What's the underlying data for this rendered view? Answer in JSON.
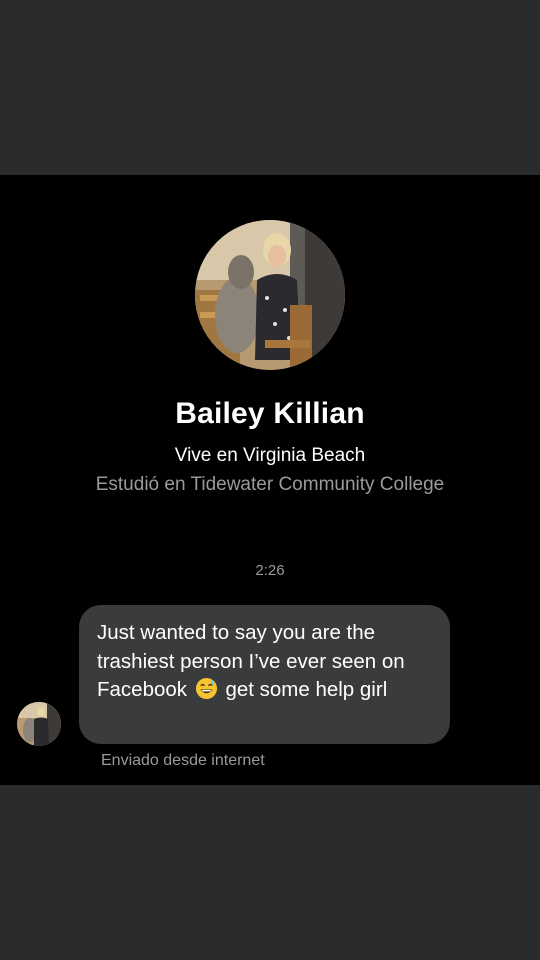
{
  "profile": {
    "name": "Bailey Killian",
    "location": "Vive en Virginia Beach",
    "education": "Estudió en Tidewater Community College",
    "photo_icon": "profile-photo"
  },
  "conversation": {
    "timestamp": "2:26",
    "message": {
      "text_before_emoji": "Just wanted to say you are the trashiest person I’ve ever seen on Facebook",
      "emoji_icon": "grinning-sweat-emoji-icon",
      "text_after_emoji": "get some help girl"
    },
    "sent_via": "Enviado desde internet"
  },
  "colors": {
    "page_background": "#2a2b2d",
    "chat_background": "#000000",
    "bubble_background": "#3a3b3c",
    "secondary_text": "#9a9a9a",
    "primary_text": "#ffffff"
  }
}
